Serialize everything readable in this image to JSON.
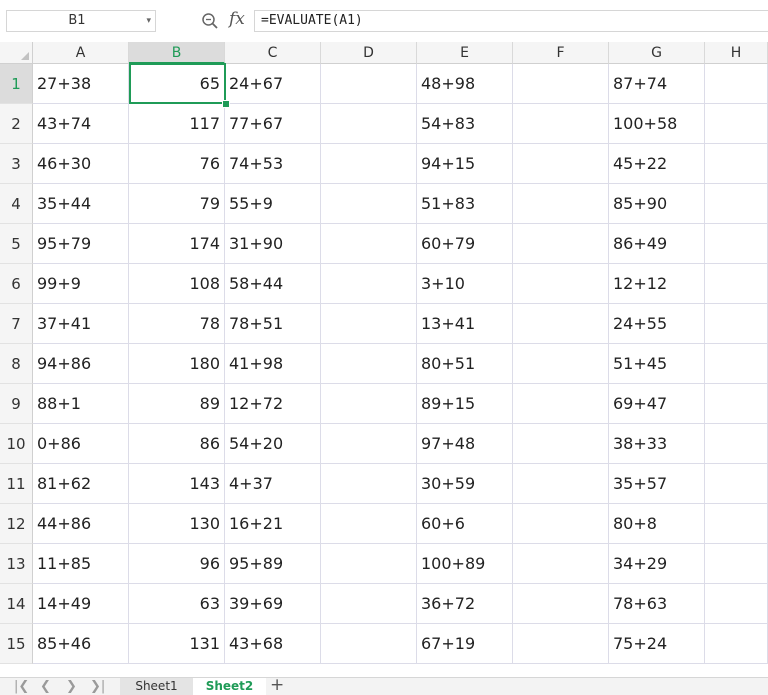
{
  "formula_bar": {
    "cell_ref": "B1",
    "fx_label": "fx",
    "formula": "=EVALUATE(A1)"
  },
  "columns": [
    "A",
    "B",
    "C",
    "D",
    "E",
    "F",
    "G",
    "H"
  ],
  "selected_column": "B",
  "rows": [
    {
      "num": "1",
      "A": "27+38",
      "B": "65",
      "C": "24+67",
      "E": "48+98",
      "G": "87+74"
    },
    {
      "num": "2",
      "A": "43+74",
      "B": "117",
      "C": "77+67",
      "E": "54+83",
      "G": "100+58"
    },
    {
      "num": "3",
      "A": "46+30",
      "B": "76",
      "C": "74+53",
      "E": "94+15",
      "G": "45+22"
    },
    {
      "num": "4",
      "A": "35+44",
      "B": "79",
      "C": "55+9",
      "E": "51+83",
      "G": "85+90"
    },
    {
      "num": "5",
      "A": "95+79",
      "B": "174",
      "C": "31+90",
      "E": "60+79",
      "G": "86+49"
    },
    {
      "num": "6",
      "A": "99+9",
      "B": "108",
      "C": "58+44",
      "E": "3+10",
      "G": "12+12"
    },
    {
      "num": "7",
      "A": "37+41",
      "B": "78",
      "C": "78+51",
      "E": "13+41",
      "G": "24+55"
    },
    {
      "num": "8",
      "A": "94+86",
      "B": "180",
      "C": "41+98",
      "E": "80+51",
      "G": "51+45"
    },
    {
      "num": "9",
      "A": "88+1",
      "B": "89",
      "C": "12+72",
      "E": "89+15",
      "G": "69+47"
    },
    {
      "num": "10",
      "A": "0+86",
      "B": "86",
      "C": "54+20",
      "E": "97+48",
      "G": "38+33"
    },
    {
      "num": "11",
      "A": "81+62",
      "B": "143",
      "C": "4+37",
      "E": "30+59",
      "G": "35+57"
    },
    {
      "num": "12",
      "A": "44+86",
      "B": "130",
      "C": "16+21",
      "E": "60+6",
      "G": "80+8"
    },
    {
      "num": "13",
      "A": "11+85",
      "B": "96",
      "C": "95+89",
      "E": "100+89",
      "G": "34+29"
    },
    {
      "num": "14",
      "A": "14+49",
      "B": "63",
      "C": "39+69",
      "E": "36+72",
      "G": "78+63"
    },
    {
      "num": "15",
      "A": "85+46",
      "B": "131",
      "C": "43+68",
      "E": "67+19",
      "G": "75+24"
    }
  ],
  "sheet_tabs": [
    {
      "label": "Sheet1",
      "active": false
    },
    {
      "label": "Sheet2",
      "active": true
    }
  ],
  "colors": {
    "accent": "#1f9b57",
    "header_bg": "#f5f5f5",
    "grid_line": "#dcdce8"
  },
  "icons": {
    "zoom": "zoom-formula-icon",
    "add_sheet": "plus-icon",
    "nav_first": "first-sheet-icon",
    "nav_prev": "prev-sheet-icon",
    "nav_next": "next-sheet-icon",
    "nav_last": "last-sheet-icon"
  }
}
